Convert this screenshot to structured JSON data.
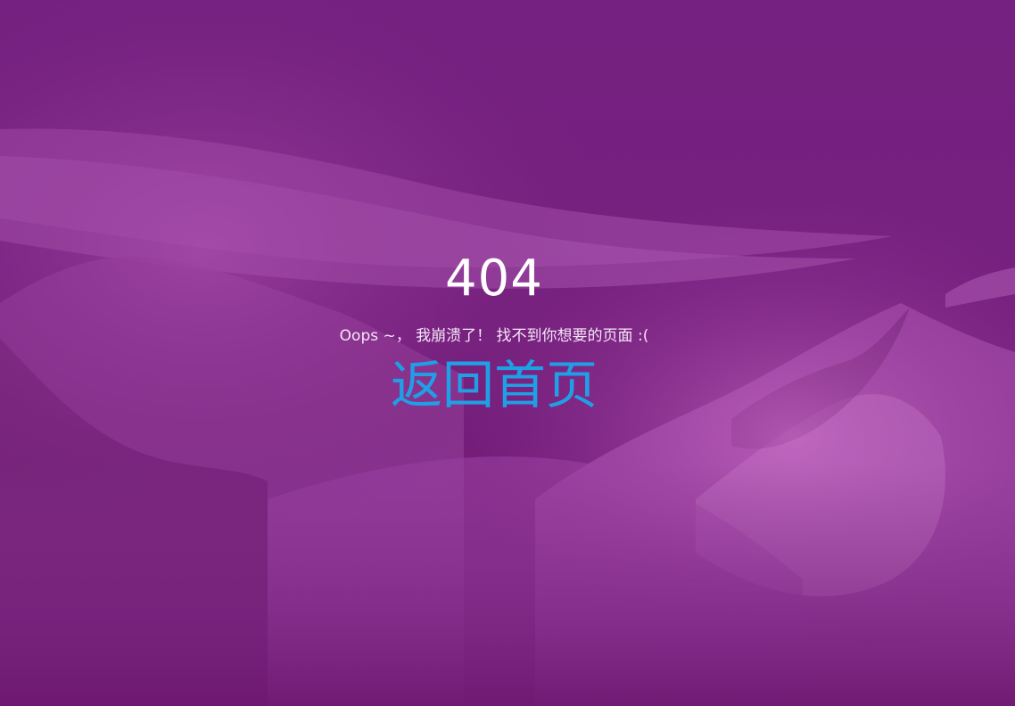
{
  "error": {
    "code": "404",
    "message": "Oops ~， 我崩溃了！ 找不到你想要的页面 :(",
    "home_link": "返回首页"
  },
  "colors": {
    "background": "#74217f",
    "link": "#1fa0e6",
    "text": "#ffffff"
  }
}
